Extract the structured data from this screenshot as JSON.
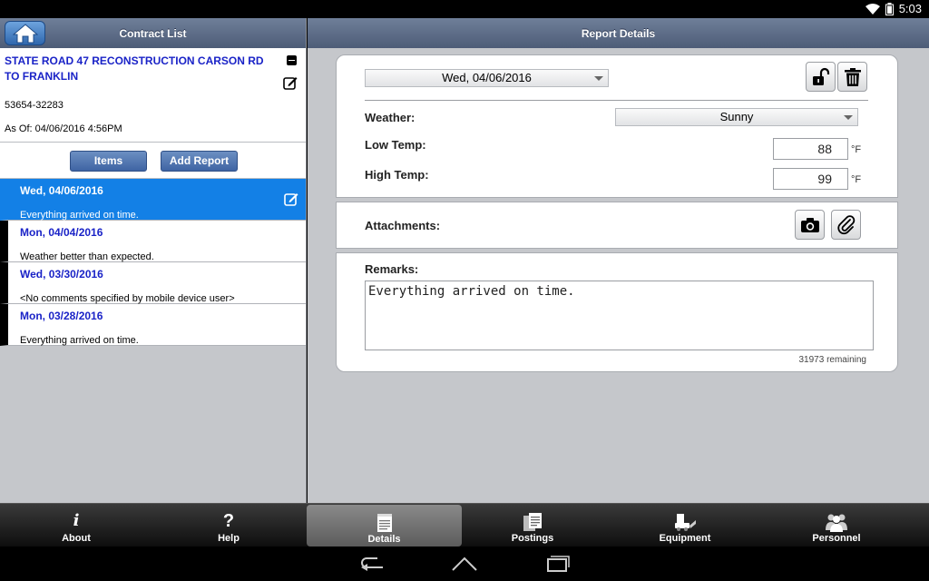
{
  "status": {
    "time": "5:03"
  },
  "left": {
    "title": "Contract List",
    "contract": {
      "name": "STATE ROAD 47 RECONSTRUCTION CARSON RD TO FRANKLIN",
      "number": "53654-32283",
      "as_of": "As Of: 04/06/2016 4:56PM"
    },
    "buttons": {
      "items": "Items",
      "add_report": "Add Report"
    },
    "reports": [
      {
        "date": "Wed, 04/06/2016",
        "note": "Everything arrived on time.",
        "selected": true
      },
      {
        "date": "Mon, 04/04/2016",
        "note": "Weather better than expected.",
        "selected": false
      },
      {
        "date": "Wed, 03/30/2016",
        "note": "<No comments specified by mobile device user>",
        "selected": false
      },
      {
        "date": "Mon, 03/28/2016",
        "note": "Everything arrived on time.",
        "selected": false
      }
    ]
  },
  "right": {
    "title": "Report Details",
    "date_value": "Wed, 04/06/2016",
    "weather": {
      "label": "Weather:",
      "value": "Sunny"
    },
    "low_temp": {
      "label": "Low Temp:",
      "value": "88",
      "unit": "°F"
    },
    "high_temp": {
      "label": "High Temp:",
      "value": "99",
      "unit": "°F"
    },
    "attachments_label": "Attachments:",
    "remarks": {
      "label": "Remarks:",
      "value": "Everything arrived on time.",
      "remaining": "31973 remaining"
    }
  },
  "tabs": [
    {
      "label": "About",
      "icon": "info-icon",
      "active": false
    },
    {
      "label": "Help",
      "icon": "help-icon",
      "active": false
    },
    {
      "label": "Details",
      "icon": "notepad-icon",
      "active": true
    },
    {
      "label": "Postings",
      "icon": "documents-icon",
      "active": false
    },
    {
      "label": "Equipment",
      "icon": "equipment-icon",
      "active": false
    },
    {
      "label": "Personnel",
      "icon": "people-icon",
      "active": false
    }
  ],
  "colors": {
    "selected_row": "#1380e6",
    "link_blue": "#1a23c7",
    "header": "#5d6c87"
  }
}
